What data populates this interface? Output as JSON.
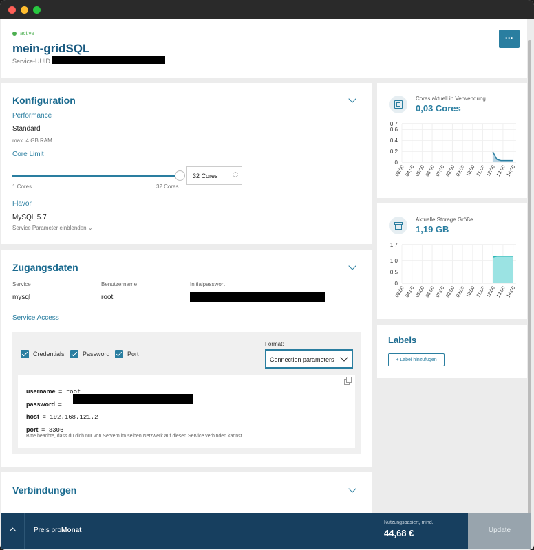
{
  "header": {
    "status": "active",
    "title": "mein-gridSQL",
    "uuid_label": "Service-UUID c",
    "menu_label": "···"
  },
  "config": {
    "title": "Konfiguration",
    "performance_label": "Performance",
    "performance_value": "Standard",
    "performance_sub": "max. 4 GB RAM",
    "core_limit_label": "Core Limit",
    "core_value": "32 Cores",
    "core_fraction": 1.0,
    "range_min": "1 Cores",
    "range_max": "32 Cores",
    "flavor_label": "Flavor",
    "flavor_value": "MySQL 5.7",
    "params_toggle": "Service Parameter einblenden"
  },
  "access": {
    "title": "Zugangsdaten",
    "col_service": "Service",
    "col_user": "Benutzername",
    "col_pass": "Initialpasswort",
    "service": "mysql",
    "user": "root",
    "service_access": "Service Access",
    "cb_credentials": "Credentials",
    "cb_password": "Password",
    "cb_port": "Port",
    "format_label": "Format:",
    "format_value": "Connection parameters",
    "k_username": "username",
    "v_username": "= root",
    "k_password": "password",
    "v_password": "=",
    "k_host": "host",
    "v_host": "= 192.168.121.2",
    "k_port": "port",
    "v_port": "= 3306",
    "note": "Bitte beachte, dass du dich nur von Servern im selben Netzwerk auf diesen Service verbinden kannst."
  },
  "connections": {
    "title": "Verbindungen"
  },
  "cores_chart": {
    "label": "Cores aktuell in Verwendung",
    "value": "0,03 Cores"
  },
  "storage_chart": {
    "label": "Aktuelle Storage Größe",
    "value": "1,19 GB"
  },
  "labels": {
    "title": "Labels",
    "add": "+ Label hinzufügen"
  },
  "footer": {
    "price_prefix": "Preis pro",
    "price_period": "Monat",
    "price_note": "Nutzungsbasiert, mind.",
    "price": "44,68 €",
    "update": "Update"
  },
  "colors": {
    "accent": "#2a7ea0",
    "footer": "#173f5f",
    "active": "#4caf50"
  },
  "chart_data": [
    {
      "type": "area",
      "x": [
        "03:00",
        "04:00",
        "05:00",
        "06:00",
        "07:00",
        "08:00",
        "09:00",
        "10:00",
        "11:00",
        "12:00",
        "13:00",
        "14:00"
      ],
      "yticks": [
        0,
        0.2,
        0.4,
        0.6,
        0.7
      ],
      "ylim": [
        0,
        0.7
      ],
      "series": [
        {
          "points": [
            [
              12.0,
              0.19
            ],
            [
              12.4,
              0.05
            ],
            [
              12.8,
              0.03
            ],
            [
              14.0,
              0.03
            ]
          ]
        }
      ]
    },
    {
      "type": "area",
      "x": [
        "03:00",
        "04:00",
        "05:00",
        "06:00",
        "07:00",
        "08:00",
        "09:00",
        "10:00",
        "11:00",
        "12:00",
        "13:00",
        "14:00"
      ],
      "yticks": [
        0,
        0.5,
        1.0,
        1.7
      ],
      "ylim": [
        0,
        1.7
      ],
      "series": [
        {
          "points": [
            [
              12.0,
              1.15
            ],
            [
              12.4,
              1.19
            ],
            [
              14.0,
              1.19
            ]
          ]
        }
      ]
    }
  ]
}
